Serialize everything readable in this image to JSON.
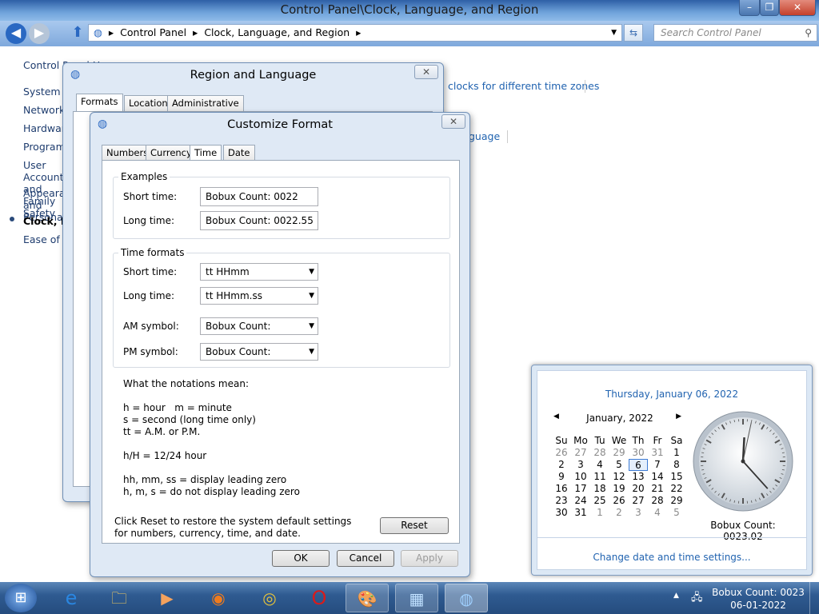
{
  "window": {
    "title": "Control Panel\\Clock, Language, and Region"
  },
  "address": {
    "crumbs": [
      "Control Panel",
      "Clock, Language, and Region"
    ],
    "search_placeholder": "Search Control Panel"
  },
  "leftnav": {
    "items": [
      "Control Panel Home",
      "System and Security",
      "Network and Internet",
      "Hardware and Sound",
      "Programs",
      "User Accounts and Family Safety",
      "Appearance and Personalization",
      "Clock, Language, and Region",
      "Ease of Access"
    ]
  },
  "background_links": [
    "clocks for different time zones",
    "guage"
  ],
  "region_dialog": {
    "title": "Region and Language",
    "tabs": [
      "Formats",
      "Location",
      "Administrative"
    ]
  },
  "customize": {
    "title": "Customize Format",
    "tabs": [
      "Numbers",
      "Currency",
      "Time",
      "Date"
    ],
    "examples": {
      "label": "Examples",
      "short_label": "Short time:",
      "short_value": "Bobux Count: 0022",
      "long_label": "Long time:",
      "long_value": "Bobux Count: 0022.55"
    },
    "formats": {
      "label": "Time formats",
      "short_label": "Short time:",
      "short_value": "tt HHmm",
      "long_label": "Long time:",
      "long_value": "tt HHmm.ss",
      "am_label": "AM symbol:",
      "am_value": "Bobux Count:",
      "pm_label": "PM symbol:",
      "pm_value": "Bobux Count:"
    },
    "notes": {
      "heading": "What the notations mean:",
      "l1": "h = hour   m = minute",
      "l2": "s = second (long time only)",
      "l3": "tt = A.M. or P.M.",
      "l4": "h/H = 12/24 hour",
      "l5": "hh, mm, ss = display leading zero",
      "l6": "h, m, s = do not display leading zero"
    },
    "reset_text": "Click Reset to restore the system default settings for numbers, currency, time, and date.",
    "reset_label": "Reset",
    "ok_label": "OK",
    "cancel_label": "Cancel",
    "apply_label": "Apply"
  },
  "flyout": {
    "date_heading": "Thursday, January 06, 2022",
    "month_label": "January, 2022",
    "weekdays": [
      "Su",
      "Mo",
      "Tu",
      "We",
      "Th",
      "Fr",
      "Sa"
    ],
    "weeks": [
      [
        "26",
        "27",
        "28",
        "29",
        "30",
        "31",
        "1"
      ],
      [
        "2",
        "3",
        "4",
        "5",
        "6",
        "7",
        "8"
      ],
      [
        "9",
        "10",
        "11",
        "12",
        "13",
        "14",
        "15"
      ],
      [
        "16",
        "17",
        "18",
        "19",
        "20",
        "21",
        "22"
      ],
      [
        "23",
        "24",
        "25",
        "26",
        "27",
        "28",
        "29"
      ],
      [
        "30",
        "31",
        "1",
        "2",
        "3",
        "4",
        "5"
      ]
    ],
    "selected_day": "6",
    "clock_caption": "Bobux Count: 0023.02",
    "settings_link": "Change date and time settings..."
  },
  "tray": {
    "time": "Bobux Count: 0023",
    "date": "06-01-2022"
  },
  "colors": {
    "accent": "#2163b0",
    "titlebar": "#2e5fa6",
    "taskbar": "#2f5b91"
  }
}
